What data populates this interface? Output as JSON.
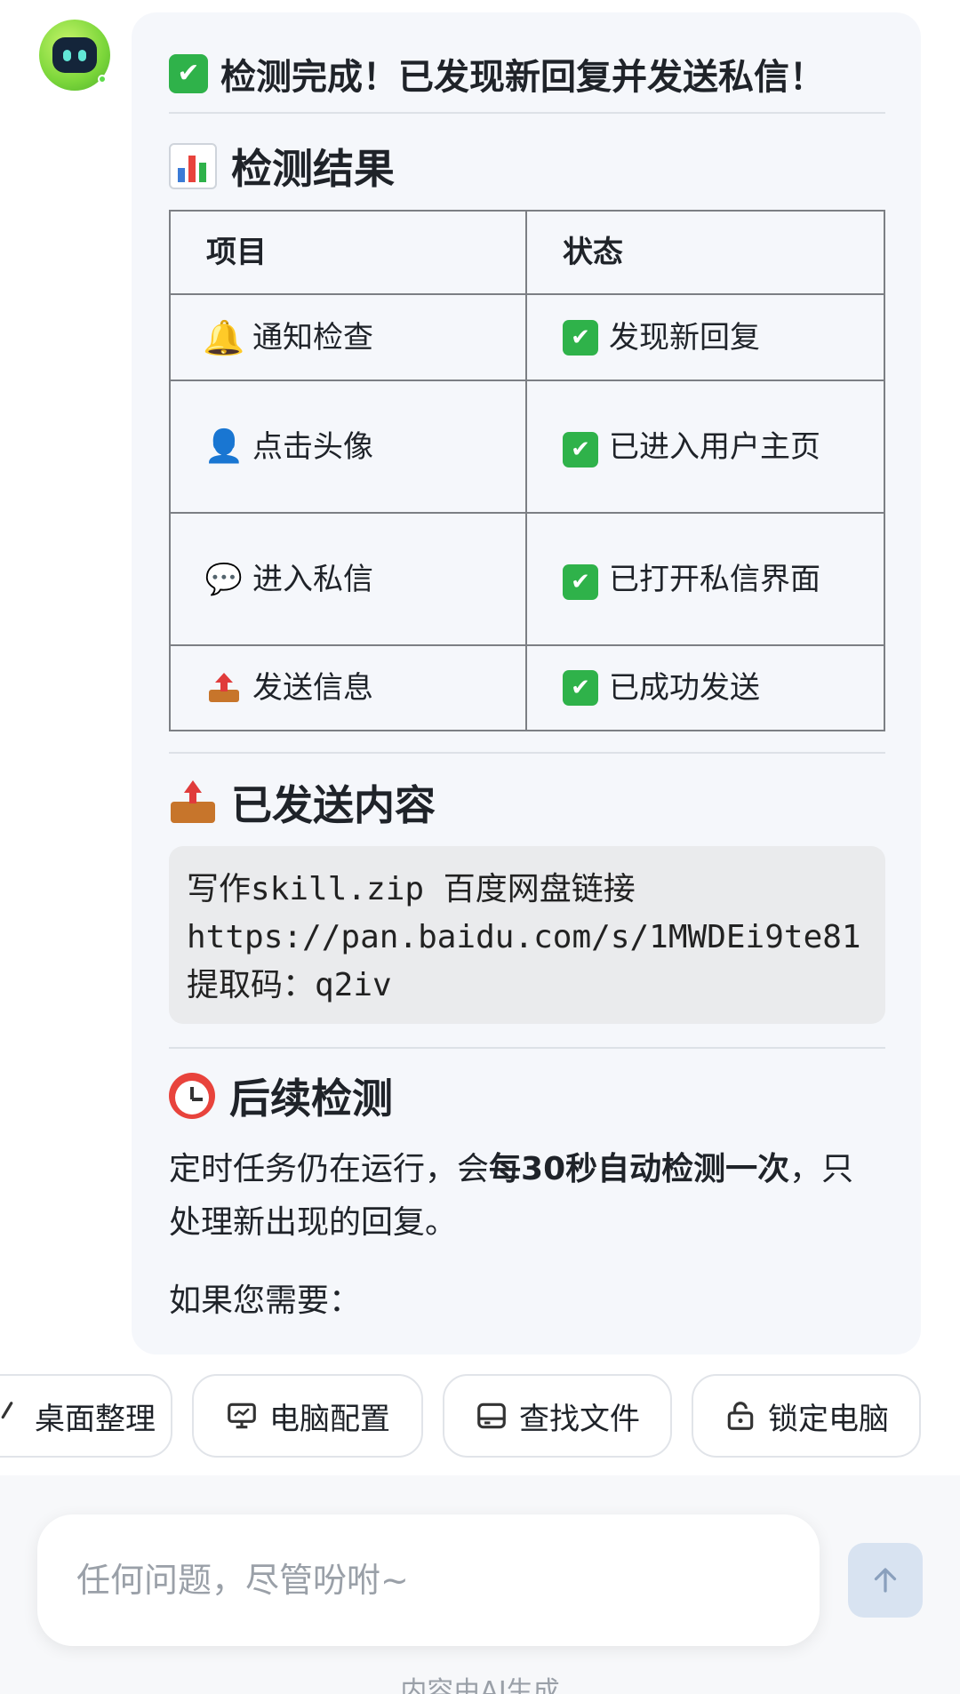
{
  "header": {
    "headline": "检测完成！已发现新回复并发送私信！"
  },
  "results": {
    "title": "检测结果",
    "columns": [
      "项目",
      "状态"
    ],
    "rows": [
      {
        "icon": "bell-icon",
        "item": "通知检查",
        "status": "发现新回复"
      },
      {
        "icon": "person-icon",
        "item": "点击头像",
        "status": "已进入用户主页"
      },
      {
        "icon": "speech-bubble-icon",
        "item": "进入私信",
        "status": "已打开私信界面"
      },
      {
        "icon": "outbox-icon",
        "item": "发送信息",
        "status": "已成功发送"
      }
    ]
  },
  "sent": {
    "title": "已发送内容",
    "line1": "写作skill.zip 百度网盘链接",
    "line2": "https://pan.baidu.com/s/1MWDEi9te81",
    "line3": "提取码：q2iv"
  },
  "followup": {
    "title": "后续检测",
    "text_pre": "定时任务仍在运行，会",
    "text_bold": "每30秒自动检测一次",
    "text_post": "，只处理新出现的回复。",
    "if_need": "如果您需要："
  },
  "chips": [
    {
      "label": "桌面整理",
      "icon": "broom-icon"
    },
    {
      "label": "电脑配置",
      "icon": "monitor-icon"
    },
    {
      "label": "查找文件",
      "icon": "drive-icon"
    },
    {
      "label": "锁定电脑",
      "icon": "lock-icon"
    }
  ],
  "composer": {
    "placeholder": "任何问题，尽管吩咐~",
    "footer": "内容由AI生成"
  },
  "colors": {
    "accent_check": "#2fb24a",
    "bubble_bg": "#f5f7fb",
    "send_button": "#d8e3f1"
  }
}
